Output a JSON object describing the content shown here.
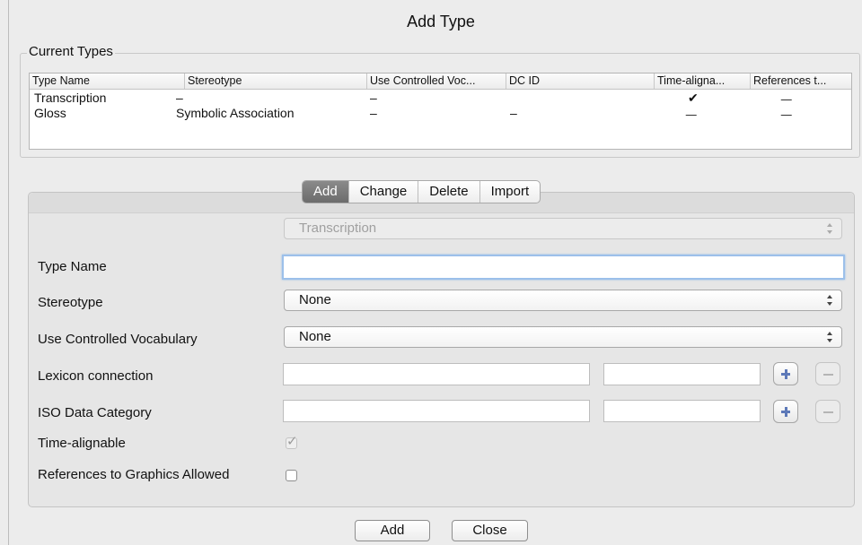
{
  "window": {
    "title": "Add Type"
  },
  "current_types": {
    "legend": "Current Types",
    "columns": [
      "Type Name",
      "Stereotype",
      "Use Controlled Voc...",
      "DC ID",
      "Time-aligna...",
      "References t..."
    ],
    "rows": [
      {
        "type_name": "Transcription",
        "stereotype": "–",
        "use_cv": "–",
        "dc_id": "",
        "time_alignable": "✔",
        "references": ""
      },
      {
        "type_name": "Gloss",
        "stereotype": "Symbolic Association",
        "use_cv": "–",
        "dc_id": "–",
        "time_alignable": "",
        "references": ""
      }
    ]
  },
  "tabs": [
    {
      "label": "Add",
      "active": true
    },
    {
      "label": "Change",
      "active": false
    },
    {
      "label": "Delete",
      "active": false
    },
    {
      "label": "Import",
      "active": false
    }
  ],
  "form": {
    "type_selector": {
      "value": "Transcription",
      "disabled": true
    },
    "type_name": {
      "label": "Type Name",
      "value": ""
    },
    "stereotype": {
      "label": "Stereotype",
      "value": "None"
    },
    "use_cv": {
      "label": "Use Controlled Vocabulary",
      "value": "None"
    },
    "lexicon": {
      "label": "Lexicon connection",
      "value1": "",
      "value2": ""
    },
    "iso": {
      "label": "ISO Data Category",
      "value1": "",
      "value2": ""
    },
    "time_alignable": {
      "label": "Time-alignable",
      "checked": true,
      "disabled": true,
      "mark": "✓"
    },
    "references": {
      "label": "References to Graphics Allowed",
      "checked": false
    }
  },
  "buttons": {
    "add": "Add",
    "close": "Close"
  }
}
